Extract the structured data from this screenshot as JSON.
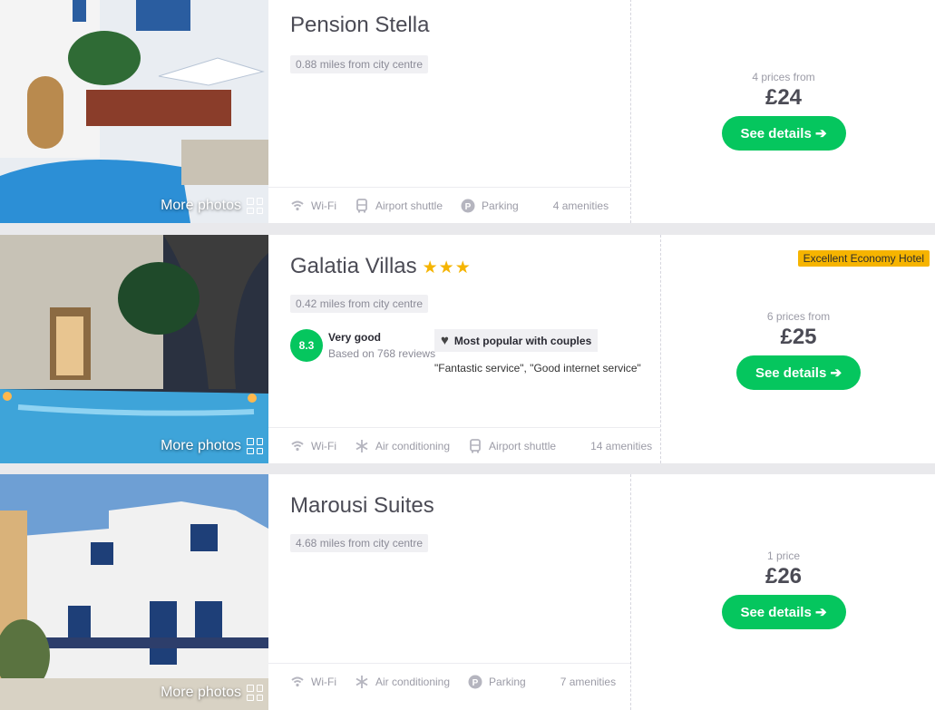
{
  "hotels": [
    {
      "name": "Pension Stella",
      "distance": "0.88 miles from city centre",
      "more_photos": "More photos",
      "amenities": [
        "Wi-Fi",
        "Airport shuttle",
        "Parking"
      ],
      "amenities_count": "4 amenities",
      "prices_from": "4 prices from",
      "price": "£24",
      "cta": "See details ➔"
    },
    {
      "name": "Galatia Villas",
      "stars": "★★★",
      "star_rating": 3,
      "distance": "0.42 miles from city centre",
      "score": "8.3",
      "rating_label": "Very good",
      "reviews": "Based on 768 reviews",
      "popular": "Most popular with couples",
      "quotes": "\"Fantastic service\", \"Good internet service\"",
      "badge": "Excellent Economy Hotel",
      "more_photos": "More photos",
      "amenities": [
        "Wi-Fi",
        "Air conditioning",
        "Airport shuttle"
      ],
      "amenities_count": "14 amenities",
      "prices_from": "6 prices from",
      "price": "£25",
      "cta": "See details ➔"
    },
    {
      "name": "Marousi Suites",
      "distance": "4.68 miles from city centre",
      "more_photos": "More photos",
      "amenities": [
        "Wi-Fi",
        "Air conditioning",
        "Parking"
      ],
      "amenities_count": "7 amenities",
      "prices_from": "1 price",
      "price": "£26",
      "cta": "See details ➔"
    }
  ],
  "colors": {
    "accent": "#05c65e",
    "badge": "#f6b400",
    "star": "#f5b400"
  },
  "icons": [
    "wifi-icon",
    "bus-icon",
    "parking-icon",
    "snowflake-icon",
    "heart-icon",
    "grid-icon",
    "arrow-right-icon"
  ]
}
